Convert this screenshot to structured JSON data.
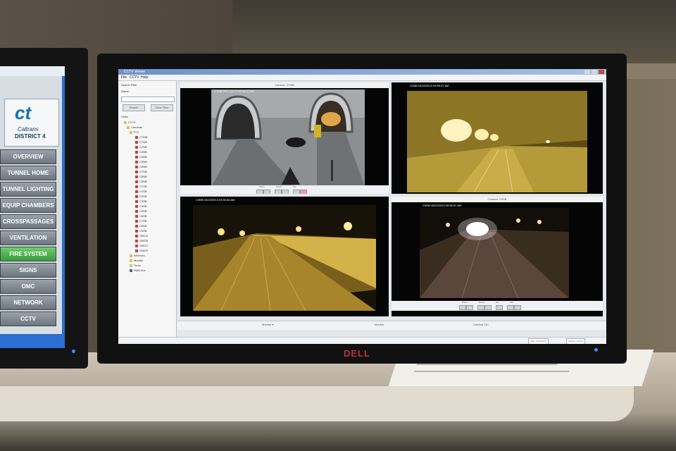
{
  "colors": {
    "accent": "#6c91c9",
    "active": "#4caf50",
    "brand_logo": "#1a6fb0",
    "dell": "#b33333"
  },
  "left_panel": {
    "logo_mark": "ct",
    "logo_brand": "Caltrans",
    "logo_district": "DISTRICT 4",
    "buttons": [
      {
        "label": "OVERVIEW"
      },
      {
        "label": "TUNNEL HOME"
      },
      {
        "label": "TUNNEL LIGHTING"
      },
      {
        "label": "EQUIP CHAMBERS"
      },
      {
        "label": "CROSSPASSAGES"
      },
      {
        "label": "VENTILATION"
      },
      {
        "label": "FIRE SYSTEM",
        "active": true
      },
      {
        "label": "SIGNS"
      },
      {
        "label": "OMC"
      },
      {
        "label": "NETWORK"
      },
      {
        "label": "CCTV"
      }
    ]
  },
  "main_monitor": {
    "brand": "DELL",
    "window_title": "CCTV Viewer",
    "menu": [
      "File",
      "CCTV",
      "Help"
    ],
    "search": {
      "label": "Search Filter",
      "name_label": "Name:",
      "search_btn": "Search",
      "clear_btn": "Clear Filter"
    },
    "tree_root": "Video",
    "tree": [
      {
        "label": "CCTV",
        "icon": "folder"
      },
      {
        "label": "Cameras",
        "icon": "folder"
      },
      {
        "label": "FF2",
        "icon": "folder"
      },
      {
        "label": "CTMB",
        "icon": "camera"
      },
      {
        "label": "CTNB",
        "icon": "camera"
      },
      {
        "label": "C2NB",
        "icon": "camera"
      },
      {
        "label": "C3NB",
        "icon": "camera"
      },
      {
        "label": "C4NB",
        "icon": "camera"
      },
      {
        "label": "C5NB",
        "icon": "camera"
      },
      {
        "label": "C6NB",
        "icon": "camera"
      },
      {
        "label": "C7NB",
        "icon": "camera"
      },
      {
        "label": "C8NB",
        "icon": "camera"
      },
      {
        "label": "C9NB",
        "icon": "camera"
      },
      {
        "label": "CTSB",
        "icon": "camera"
      },
      {
        "label": "C1SB",
        "icon": "camera"
      },
      {
        "label": "C2SB",
        "icon": "camera"
      },
      {
        "label": "C3SB",
        "icon": "camera"
      },
      {
        "label": "C4SB",
        "icon": "camera"
      },
      {
        "label": "C5SB",
        "icon": "camera"
      },
      {
        "label": "C6SB",
        "icon": "camera"
      },
      {
        "label": "C7SB",
        "icon": "camera"
      },
      {
        "label": "C8SB",
        "icon": "camera"
      },
      {
        "label": "C9SB",
        "icon": "camera"
      },
      {
        "label": "OMCA",
        "icon": "camera"
      },
      {
        "label": "OMCB",
        "icon": "camera"
      },
      {
        "label": "OMCC",
        "icon": "camera"
      },
      {
        "label": "OMCD",
        "icon": "camera"
      },
      {
        "label": "Intercom",
        "icon": "folder"
      },
      {
        "label": "Monitor",
        "icon": "folder"
      },
      {
        "label": "Tours",
        "icon": "folder"
      },
      {
        "label": "NMB tour",
        "icon": "tour"
      }
    ],
    "feeds": [
      {
        "caption": "Camera: CTMB",
        "timestamp": "CTMB FPC-CS-17 09:55:37 AM",
        "scene": "portal"
      },
      {
        "caption": "",
        "timestamp": "C2NB 03/22/2013 09:55:37 AM",
        "scene": "tunnel-bright"
      },
      {
        "caption": "",
        "timestamp": "C4NB 03/22/2013 09:55:36 AM",
        "scene": "tunnel-mid"
      },
      {
        "caption": "Camera: C9SB",
        "timestamp": "C9SB 03/22/2013 09:55:37 AM",
        "scene": "tunnel-dark"
      }
    ],
    "feed_controls": [
      "Zoom",
      "Focus",
      "Iris",
      "Pan"
    ],
    "status": {
      "left": "Monitor ▾",
      "center": "Monitor",
      "right": "Camera Ctrl",
      "box1": "User: Connected",
      "box2": "Version: 1.0.0.0"
    }
  }
}
